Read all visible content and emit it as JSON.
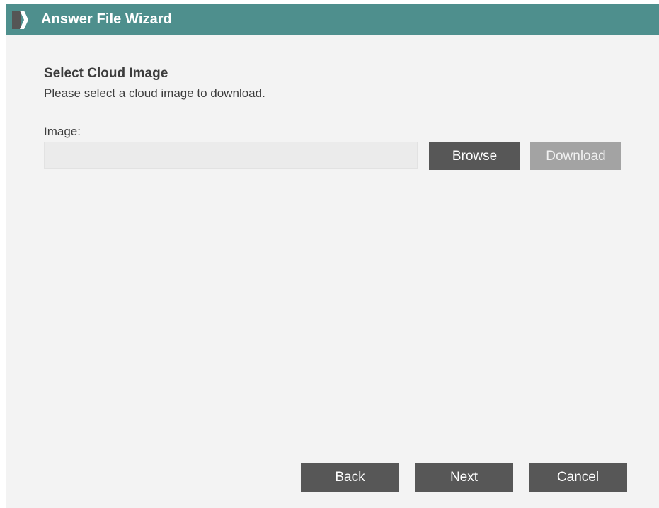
{
  "window": {
    "title": "Answer File Wizard",
    "title_icon": "wizard-chevron-icon"
  },
  "page": {
    "heading": "Select Cloud Image",
    "subheading": "Please select a cloud image to download."
  },
  "image_field": {
    "label": "Image:",
    "value": "",
    "placeholder": ""
  },
  "buttons": {
    "browse": "Browse",
    "download": "Download",
    "back": "Back",
    "next": "Next",
    "cancel": "Cancel"
  },
  "colors": {
    "titlebar": "#4e8f8d",
    "button": "#575757",
    "button_disabled": "#a3a3a3",
    "background": "#f3f3f3"
  }
}
